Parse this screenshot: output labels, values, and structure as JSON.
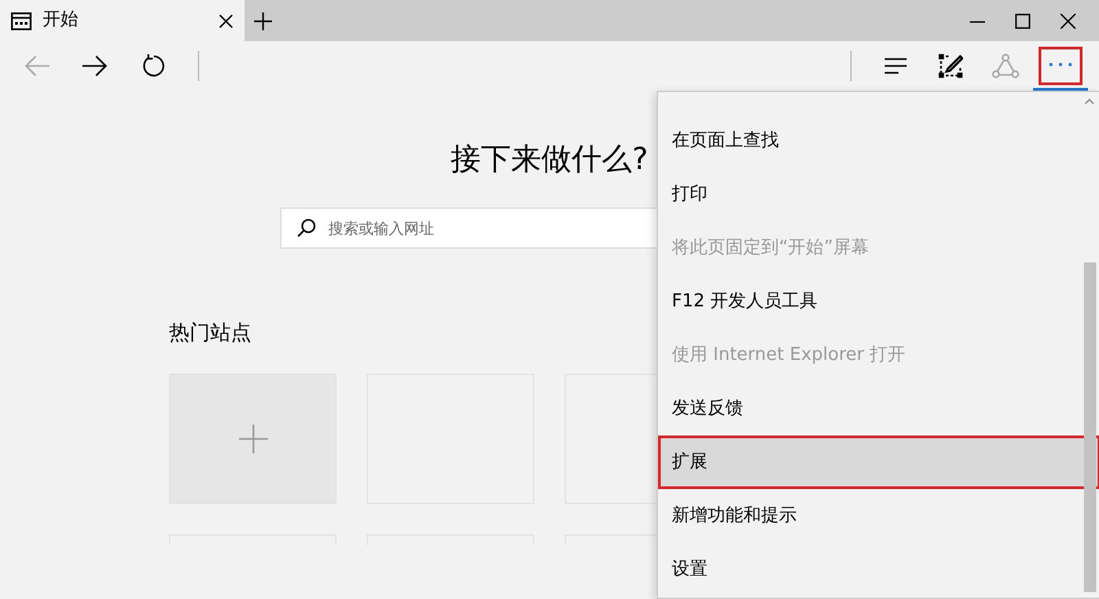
{
  "tab": {
    "title": "开始",
    "selected": true
  },
  "toolbar": {
    "nav": [
      {
        "kind": "back",
        "disabled": true
      },
      {
        "kind": "forward",
        "disabled": false
      },
      {
        "kind": "refresh",
        "disabled": false
      }
    ],
    "actions": [
      {
        "kind": "hub",
        "disabled": false,
        "selected": false,
        "highlighted": false
      },
      {
        "kind": "notes",
        "disabled": false,
        "selected": false,
        "highlighted": false
      },
      {
        "kind": "share",
        "disabled": true,
        "selected": false,
        "highlighted": false
      },
      {
        "kind": "more",
        "disabled": false,
        "selected": true,
        "highlighted": true
      }
    ]
  },
  "page": {
    "heading": "接下来做什么?",
    "search": {
      "placeholder": "搜索或输入网址"
    },
    "top_sites": {
      "title": "热门站点",
      "tiles": [
        {
          "kind": "add"
        },
        {
          "kind": "empty"
        },
        {
          "kind": "empty"
        },
        {
          "kind": "empty"
        },
        {
          "kind": "empty"
        },
        {
          "kind": "empty"
        }
      ]
    }
  },
  "menu": {
    "items": [
      {
        "label": "在页面上查找",
        "disabled": false,
        "highlighted": false
      },
      {
        "label": "打印",
        "disabled": false,
        "highlighted": false
      },
      {
        "label": "将此页固定到“开始”屏幕",
        "disabled": true,
        "highlighted": false
      },
      {
        "label": "F12 开发人员工具",
        "disabled": false,
        "highlighted": false
      },
      {
        "label": "使用 Internet Explorer 打开",
        "disabled": true,
        "highlighted": false
      },
      {
        "label": "发送反馈",
        "disabled": false,
        "highlighted": false
      },
      {
        "label": "扩展",
        "disabled": false,
        "highlighted": true
      },
      {
        "label": "新增功能和提示",
        "disabled": false,
        "highlighted": false
      },
      {
        "label": "设置",
        "disabled": false,
        "highlighted": false
      }
    ]
  }
}
